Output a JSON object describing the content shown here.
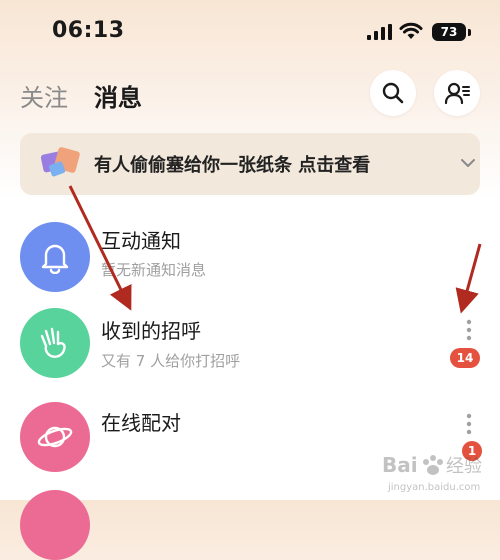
{
  "status_bar": {
    "time": "06:13",
    "battery": "73"
  },
  "header": {
    "tab_follow": "关注",
    "tab_messages": "消息",
    "search_icon": "search-icon",
    "contacts_icon": "contacts-icon"
  },
  "banner": {
    "text": "有人偷偷塞给你一张纸条 点击查看",
    "icon": "paper-note-icon"
  },
  "items": [
    {
      "title": "互动通知",
      "subtitle": "暂无新通知消息",
      "icon": "bell-icon",
      "color": "#6f8ff0"
    },
    {
      "title": "收到的招呼",
      "subtitle": "又有 7 人给你打招呼",
      "icon": "wave-hand-icon",
      "color": "#58d39c",
      "badge": "14"
    },
    {
      "title": "在线配对",
      "subtitle": "",
      "icon": "planet-icon",
      "color": "#ec6b94",
      "badge": "1"
    }
  ],
  "watermark": {
    "text": "Bai 经验",
    "sub": "jingyan.baidu.com"
  },
  "colors": {
    "badge": "#e4523f",
    "arrow": "#b02a20",
    "banner_bg": "#f2e8dc"
  }
}
